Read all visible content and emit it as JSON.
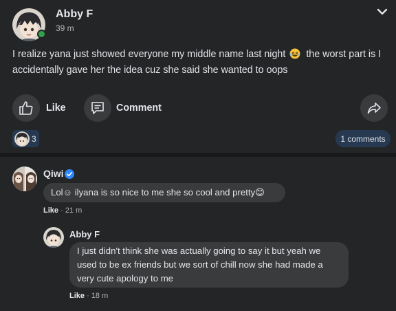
{
  "post": {
    "author": "Abby F",
    "time": "39 m",
    "text_before_emoji": "I realize yana just showed everyone my middle name last night",
    "text_after_emoji": "the worst part is I accidentally gave her the idea cuz she said she wanted to oops",
    "actions": {
      "like": "Like",
      "comment": "Comment"
    },
    "reaction_count": "3",
    "comments_count": "1 comments"
  },
  "comments": [
    {
      "name": "Qiwi",
      "text": "Lol☺ ilyana is so nice to me she so cool and pretty😊",
      "like": "Like",
      "time": "21 m"
    },
    {
      "name": "Abby F",
      "text": "I just didn't think she was actually going to say it but yeah we used to be ex friends but we sort of chill now she had made a very cute apology to me",
      "like": "Like",
      "time": "18 m"
    }
  ],
  "colors": {
    "card": "#242526",
    "bubble": "#3a3b3c",
    "badge": "#263951",
    "online": "#31a24c",
    "verified": "#2d88ff"
  }
}
